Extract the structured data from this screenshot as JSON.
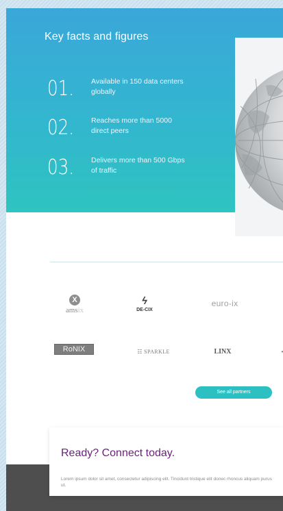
{
  "hero": {
    "title": "Key facts and figures",
    "facts": [
      {
        "number": "01.",
        "text": "Available in 150 data centers globally"
      },
      {
        "number": "02.",
        "text": "Reaches more than 5000 direct peers"
      },
      {
        "number": "03.",
        "text": "Delivers more than 500 Gbps of traffic"
      }
    ],
    "gradient_colors": [
      "#3aa7d9",
      "#2ec4c0"
    ]
  },
  "partners": {
    "logos": {
      "amsix": {
        "mark": "X",
        "text_main": "ams",
        "text_faded": "ix"
      },
      "decix": {
        "mark": "ϟ",
        "text": "DE-CIX"
      },
      "euroix": {
        "text": "euro-ix"
      },
      "ronix": {
        "text": "RoNIX"
      },
      "sparkle": {
        "text": "☷ SPARKLE"
      },
      "linx": {
        "text": "LINX"
      }
    },
    "button_label": "See all partners",
    "accent": "#2cc0c2"
  },
  "cta": {
    "title": "Ready? Connect today.",
    "body": "Lorem ipsum dolor sit amet, consectetur adipiscing elit. Tincidunt tristique elit donec rhoncus aliquam purus ut.",
    "title_color": "#6a1f7a"
  }
}
